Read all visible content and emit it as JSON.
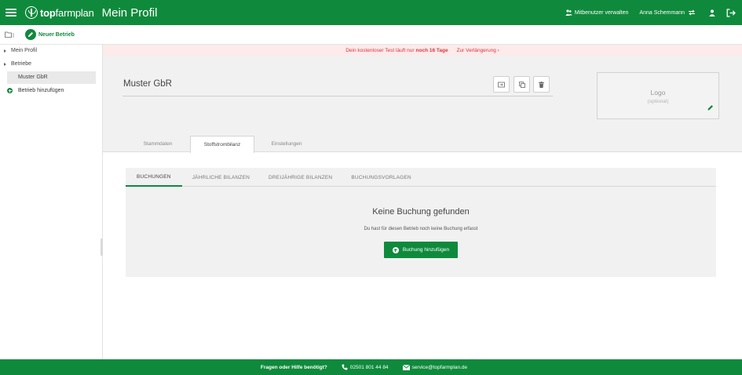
{
  "header": {
    "brand_bold": "top",
    "brand_rest": "farmplan",
    "title": "Mein Profil",
    "co_users": "Mitbenutzer verwalten",
    "user_name": "Anna Schemmann"
  },
  "toolbar": {
    "new_farm": "Neuer Betrieb"
  },
  "sidebar": {
    "items": [
      {
        "label": "Mein Profil"
      },
      {
        "label": "Betriebe"
      }
    ],
    "selected": "Muster GbR",
    "add_farm": "Betrieb hinzufügen"
  },
  "banner": {
    "pre": "Dein kostenloser Test läuft nur",
    "highlight": "noch 16 Tage",
    "link": "Zur Verlängerung"
  },
  "profile": {
    "farm_name": "Muster GbR",
    "logo_title": "Logo",
    "logo_subtitle": "(optional)",
    "tabs": [
      {
        "label": "Stammdaten"
      },
      {
        "label": "Stoffstrombilanz"
      },
      {
        "label": "Einstellungen"
      }
    ]
  },
  "content": {
    "subtabs": [
      {
        "label": "BUCHUNGEN"
      },
      {
        "label": "JÄHRLICHE BILANZEN"
      },
      {
        "label": "DREIJÄHRIGE BILANZEN"
      },
      {
        "label": "BUCHUNGSVORLAGEN"
      }
    ],
    "empty_title": "Keine Buchung gefunden",
    "empty_text": "Du hast für diesen Betrieb noch keine Buchung erfasst",
    "add_button": "Buchung hinzufügen"
  },
  "footer": {
    "question": "Fragen oder Hilfe benötigt?",
    "phone": "02501 801 44 84",
    "email": "service@topfarmplan.de"
  },
  "colors": {
    "brand_green": "#0f8a3c",
    "banner_bg": "#fdeaea",
    "banner_text": "#d9363e"
  }
}
